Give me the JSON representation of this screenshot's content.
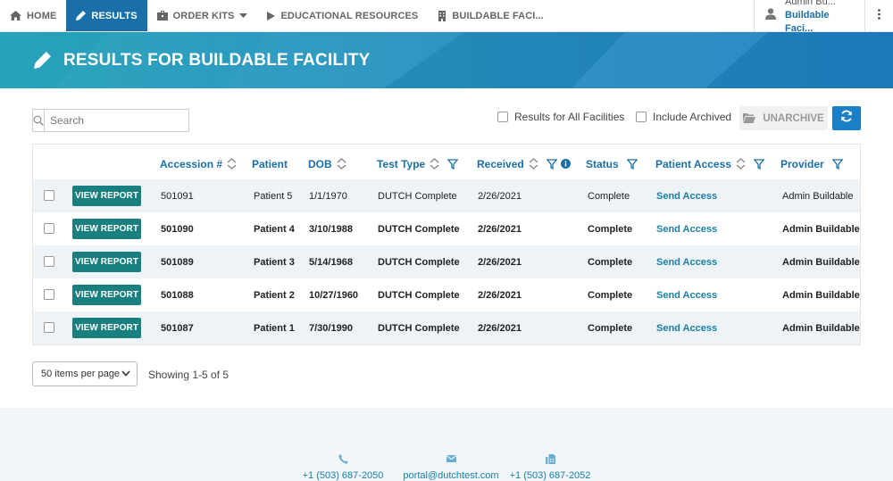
{
  "nav": {
    "home": "HOME",
    "results": "RESULTS",
    "order_kits": "ORDER KITS",
    "educational": "EDUCATIONAL RESOURCES",
    "facility": "BUILDABLE FACI...",
    "user_name": "Admin Bu...",
    "user_facility": "Buildable Faci..."
  },
  "banner": {
    "title": "RESULTS FOR BUILDABLE FACILITY"
  },
  "toolbar": {
    "search_placeholder": "Search",
    "all_facilities": "Results for All Facilities",
    "include_archived": "Include Archived",
    "unarchive": "UNARCHIVE"
  },
  "table": {
    "headers": {
      "accession": "Accession #",
      "patient": "Patient",
      "dob": "DOB",
      "test_type": "Test Type",
      "received": "Received",
      "status": "Status",
      "patient_access": "Patient Access",
      "provider": "Provider"
    },
    "view_report": "VIEW REPORT",
    "rows": [
      {
        "accession": "501091",
        "patient": "Patient 5",
        "dob": "1/1/1970",
        "test_type": "DUTCH Complete",
        "received": "2/26/2021",
        "status": "Complete",
        "access": "Send Access",
        "provider": "Admin Buildable"
      },
      {
        "accession": "501090",
        "patient": "Patient 4",
        "dob": "3/10/1988",
        "test_type": "DUTCH Complete",
        "received": "2/26/2021",
        "status": "Complete",
        "access": "Send Access",
        "provider": "Admin Buildable"
      },
      {
        "accession": "501089",
        "patient": "Patient 3",
        "dob": "5/14/1968",
        "test_type": "DUTCH Complete",
        "received": "2/26/2021",
        "status": "Complete",
        "access": "Send Access",
        "provider": "Admin Buildable"
      },
      {
        "accession": "501088",
        "patient": "Patient 2",
        "dob": "10/27/1960",
        "test_type": "DUTCH Complete",
        "received": "2/26/2021",
        "status": "Complete",
        "access": "Send Access",
        "provider": "Admin Buildable"
      },
      {
        "accession": "501087",
        "patient": "Patient 1",
        "dob": "7/30/1990",
        "test_type": "DUTCH Complete",
        "received": "2/26/2021",
        "status": "Complete",
        "access": "Send Access",
        "provider": "Admin Buildable"
      }
    ]
  },
  "paging": {
    "per_page": "50 items per page",
    "showing": "Showing 1-5 of 5"
  },
  "footer": {
    "phone": "+1 (503) 687-2050",
    "email": "portal@dutchtest.com",
    "fax": "+1 (503) 687-2052"
  },
  "icons": {
    "home": "home-icon",
    "results": "pencil-icon",
    "order_kits": "briefcase-icon",
    "educational": "play-icon",
    "facility": "building-icon",
    "user": "user-icon",
    "more": "kebab-icon",
    "search": "search-icon",
    "unarchive": "folder-icon",
    "refresh": "refresh-icon",
    "sort": "sort-icon",
    "filter": "filter-icon",
    "info": "info-icon",
    "phone": "phone-icon",
    "email": "envelope-icon",
    "fax": "fax-icon"
  },
  "colors": {
    "brand_blue": "#1a6fa8",
    "teal_button": "#1a7f7f",
    "refresh_blue": "#1a7fc6",
    "link_blue": "#1a7fa8"
  }
}
